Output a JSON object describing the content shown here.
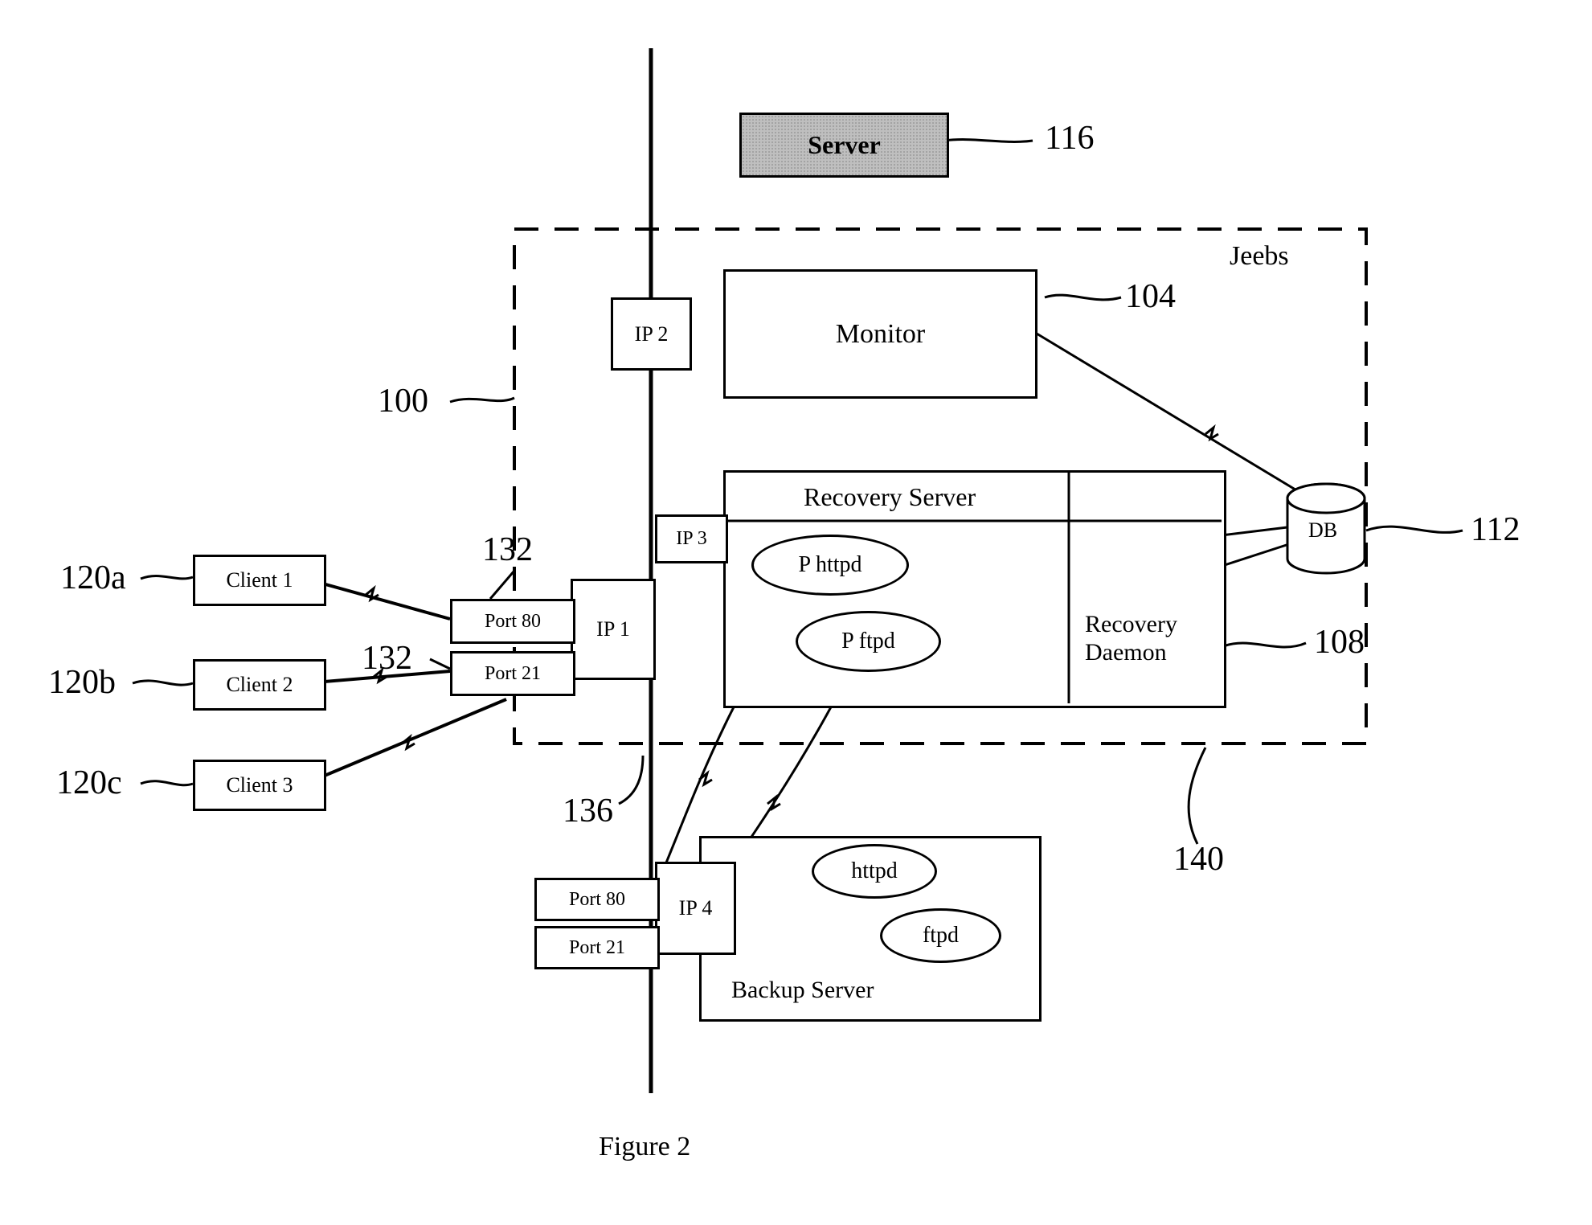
{
  "figure_caption": "Figure 2",
  "system_name": "Jeebs",
  "server": {
    "label": "Server"
  },
  "monitor": {
    "label": "Monitor"
  },
  "recovery_server": {
    "label": "Recovery Server"
  },
  "recovery_daemon": {
    "line1": "Recovery",
    "line2": "Daemon"
  },
  "backup_server": {
    "label": "Backup Server"
  },
  "db": {
    "label": "DB"
  },
  "ip": {
    "ip1": "IP 1",
    "ip2": "IP 2",
    "ip3": "IP 3",
    "ip4": "IP 4"
  },
  "ports": {
    "p80": "Port 80",
    "p21": "Port 21"
  },
  "processes": {
    "p_httpd": "P httpd",
    "p_ftpd": "P ftpd",
    "httpd": "httpd",
    "ftpd": "ftpd"
  },
  "clients": {
    "c1": "Client 1",
    "c2": "Client 2",
    "c3": "Client 3"
  },
  "callouts": {
    "c116": "116",
    "c104": "104",
    "c112": "112",
    "c100": "100",
    "c132a": "132",
    "c132b": "132",
    "c136": "136",
    "c108": "108",
    "c140": "140",
    "c120a": "120a",
    "c120b": "120b",
    "c120c": "120c"
  }
}
